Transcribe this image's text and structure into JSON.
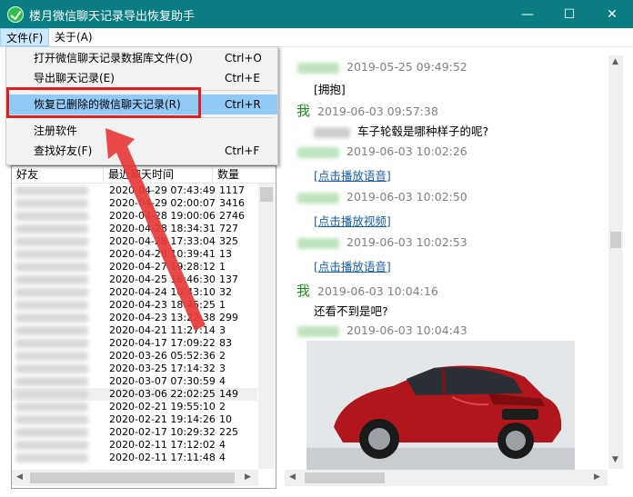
{
  "window": {
    "title": "楼月微信聊天记录导出恢复助手",
    "minimize_glyph": "—",
    "maximize_glyph": "☐",
    "close_glyph": "✕"
  },
  "menubar": {
    "file": "文件(F)",
    "about": "关于(A)"
  },
  "file_menu": {
    "items": [
      {
        "label": "打开微信聊天记录数据库文件(O)",
        "shortcut": "Ctrl+O"
      },
      {
        "label": "导出聊天记录(E)",
        "shortcut": "Ctrl+E"
      },
      {
        "label": "恢复已删除的微信聊天记录(R)",
        "shortcut": "Ctrl+R"
      },
      {
        "label": "注册软件",
        "shortcut": ""
      },
      {
        "label": "查找好友(F)",
        "shortcut": "Ctrl+F"
      }
    ],
    "highlighted_index": 2
  },
  "contacts": {
    "columns": [
      "好友",
      "最近聊天时间",
      "数量"
    ],
    "rows": [
      {
        "time": "2020-04-29 07:43:49",
        "count": "1117"
      },
      {
        "time": "2020-04-29 02:00:07",
        "count": "3416"
      },
      {
        "time": "2020-04-28 19:00:06",
        "count": "2746"
      },
      {
        "time": "2020-04-28 18:34:31",
        "count": "727"
      },
      {
        "time": "2020-04-28 17:33:04",
        "count": "325"
      },
      {
        "time": "2020-04-28 10:39:41",
        "count": "13"
      },
      {
        "time": "2020-04-27 19:28:12",
        "count": "1"
      },
      {
        "time": "2020-04-25 16:46:30",
        "count": "137"
      },
      {
        "time": "2020-04-24 10:43:10",
        "count": "32"
      },
      {
        "time": "2020-04-23 18:45:25",
        "count": "1"
      },
      {
        "time": "2020-04-23 13:22:38",
        "count": "299"
      },
      {
        "time": "2020-04-21 11:27:14",
        "count": "3"
      },
      {
        "time": "2020-04-17 17:09:22",
        "count": "83"
      },
      {
        "time": "2020-03-26 05:52:36",
        "count": "2"
      },
      {
        "time": "2020-03-25 17:14:32",
        "count": "3"
      },
      {
        "time": "2020-03-07 07:30:59",
        "count": "4"
      },
      {
        "time": "2020-03-06 22:02:25",
        "count": "149"
      },
      {
        "time": "2020-02-21 19:55:10",
        "count": "2"
      },
      {
        "time": "2020-02-21 19:14:26",
        "count": "10"
      },
      {
        "time": "2020-02-17 10:29:32",
        "count": "225"
      },
      {
        "time": "2020-02-11 17:12:02",
        "count": "4"
      },
      {
        "time": "2020-02-11 17:11:48",
        "count": "4"
      }
    ],
    "selected_index": 16
  },
  "chat": {
    "entries": [
      {
        "sender": "friend",
        "time": "2019-05-25 09:49:52",
        "text": "[拥抱]",
        "link": false
      },
      {
        "sender": "me",
        "me_label": "我",
        "time": "2019-06-03 09:57:38",
        "text": "车子轮毂是哪种样子的呢?",
        "link": false,
        "quoted": true
      },
      {
        "sender": "friend",
        "time": "2019-06-03 10:02:26",
        "text": "[点击播放语音]",
        "link": true
      },
      {
        "sender": "friend",
        "time": "2019-06-03 10:02:50",
        "text": "[点击播放视频]",
        "link": true
      },
      {
        "sender": "friend",
        "time": "2019-06-03 10:02:53",
        "text": "[点击播放语音]",
        "link": true
      },
      {
        "sender": "me",
        "me_label": "我",
        "time": "2019-06-03 10:04:16",
        "text": "还看不到是吧?",
        "link": false
      },
      {
        "sender": "friend",
        "time": "2019-06-03 10:04:43",
        "text": "",
        "link": false
      }
    ]
  },
  "colors": {
    "titlebar": "#0a7d84",
    "menu_highlight": "#91c9f7",
    "annotation_red": "#e02020",
    "link_blue": "#1a5da8",
    "me_green": "#1c8a1c"
  }
}
